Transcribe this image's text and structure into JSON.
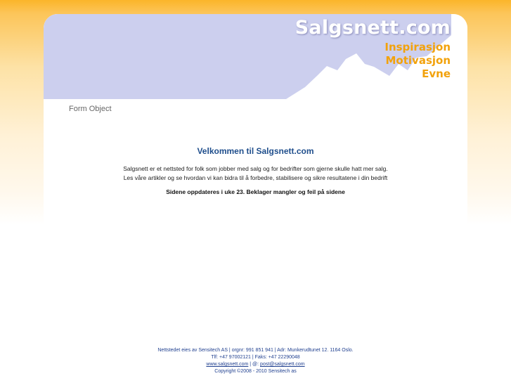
{
  "header": {
    "brand": "Salgsnett.com",
    "taglines": [
      "Inspirasjon",
      "Motivasjon",
      "Evne"
    ]
  },
  "form_object": "Form Object",
  "main": {
    "welcome": "Velkommen til Salgsnett.com",
    "intro_line1": "Salgsnett er et nettsted for folk som jobber med salg og for bedrifter som gjerne skulle hatt mer salg.",
    "intro_line2": "Les våre artikler og se hvordan vi kan bidra til å forbedre, stabilisere og sikre resultatene i din bedrift",
    "notice": "Sidene oppdateres i uke 23. Beklager mangler og feil på sidene"
  },
  "footer": {
    "line1": "Nettstedet eies av Sensitech AS  |  orgnr: 991 851 941   |  Adr: Munkerudtunet 12. 1164 Oslo.",
    "line2": "Tlf: +47 97002121  | Faks: +47 22290048",
    "website_link": "www.salgsnett.com",
    "email_prefix": " |  @: ",
    "email_link": "post@salgsnett.com",
    "copyright": "Copyright ©2008 - 2010 Sensitech as"
  },
  "colors": {
    "header_gradient": "#fbb52a",
    "banner_lavender": "#cccfee",
    "tagline_orange": "#f2a20c",
    "heading_blue": "#1f4e8c",
    "footer_blue": "#1f3f8f"
  }
}
